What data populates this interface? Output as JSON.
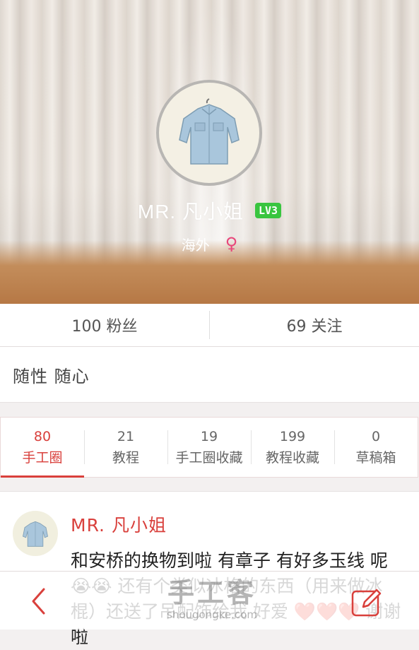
{
  "profile": {
    "username": "MR. 凡小姐",
    "level": "LV3",
    "location": "海外",
    "gender_symbol": "♀",
    "bio": "随性 随心"
  },
  "stats": {
    "fans": "100 粉丝",
    "following": "69 关注"
  },
  "tabs": [
    {
      "count": "80",
      "label": "手工圈",
      "active": true
    },
    {
      "count": "21",
      "label": "教程"
    },
    {
      "count": "19",
      "label": "手工圈收藏"
    },
    {
      "count": "199",
      "label": "教程收藏"
    },
    {
      "count": "0",
      "label": "草稿箱"
    }
  ],
  "post": {
    "author": "MR. 凡小姐",
    "text": "和安桥的换物到啦 有章子 有好多玉线 呢😭😭 还有个类似冰格的东西（用来做冰棍）还送了吊配饰给我 好爱 ❤️❤️❤️ 谢谢啦"
  },
  "watermark": {
    "big": "手工客",
    "small": "shougongke.com"
  },
  "colors": {
    "accent": "#d9403c",
    "level_badge": "#39c53f",
    "gender": "#e8467a"
  },
  "icons": {
    "back": "chevron-left-icon",
    "edit": "edit-pencil-icon"
  }
}
